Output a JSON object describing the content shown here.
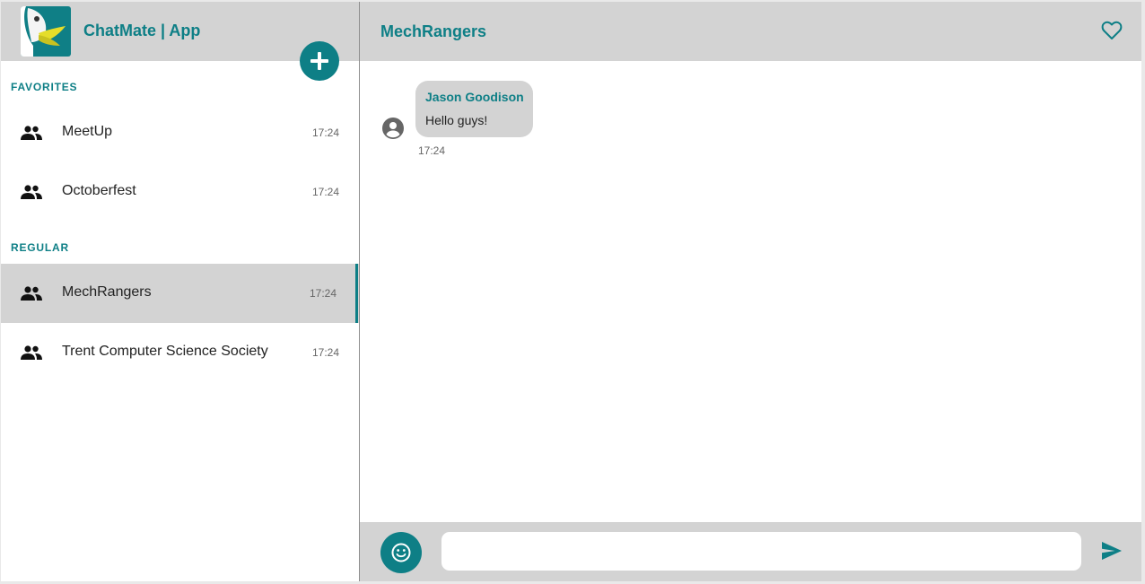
{
  "app": {
    "title": "ChatMate | App"
  },
  "sidebar": {
    "new_chat_icon": "plus-icon",
    "sections": [
      {
        "label": "FAVORITES",
        "chats": [
          {
            "name": "MeetUp",
            "time": "17:24",
            "icon": "group-icon"
          },
          {
            "name": "Octoberfest",
            "time": "17:24",
            "icon": "group-icon"
          }
        ]
      },
      {
        "label": "REGULAR",
        "chats": [
          {
            "name": "MechRangers",
            "time": "17:24",
            "icon": "group-icon",
            "active": true
          },
          {
            "name": "Trent Computer Science Society",
            "time": "17:24",
            "icon": "group-icon"
          }
        ]
      }
    ]
  },
  "chat": {
    "title": "MechRangers",
    "favorite_icon": "heart-outline-icon",
    "messages": [
      {
        "sender": "Jason Goodison",
        "text": "Hello guys!",
        "time": "17:24",
        "avatar_icon": "account-circle-icon"
      }
    ]
  },
  "composer": {
    "placeholder": "",
    "value": "",
    "emoji_icon": "smiley-icon",
    "send_icon": "send-icon"
  },
  "colors": {
    "accent": "#0e7f86",
    "header_bg": "#d3d3d3",
    "selected_bg": "#d3d3d3",
    "bubble_bg": "#d3d3d3"
  }
}
